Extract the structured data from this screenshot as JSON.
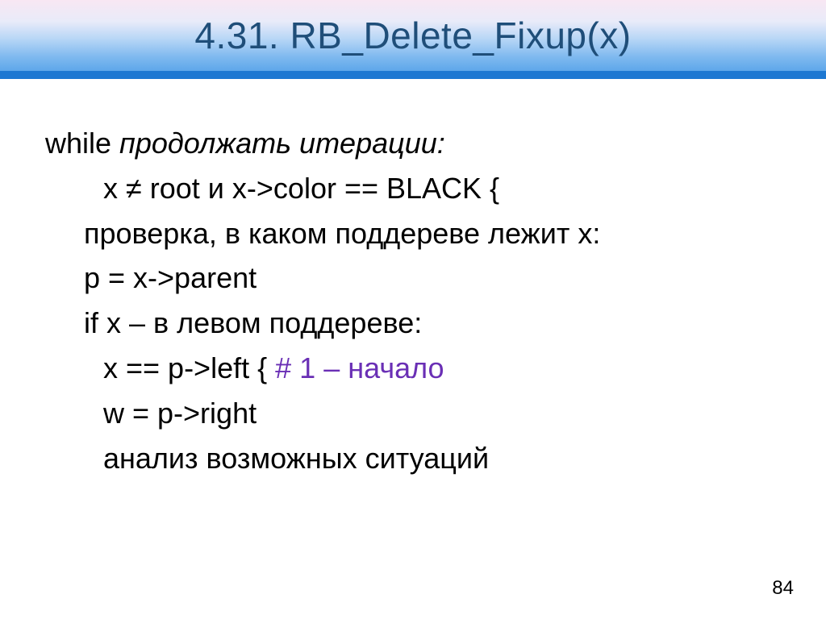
{
  "title": "4.31. RB_Delete_Fixup(x)",
  "lines": {
    "l1a": "while",
    "l1b": " продолжать итерации",
    "l1c": ":",
    "l2": "x ≠ root и x->color == BLACK {",
    "l3": "проверка, в каком поддереве лежит x:",
    "l4": "p = x->parent",
    "l5": "if x – в левом поддереве:",
    "l6a": "x == p->left { ",
    "l6b": "# 1 – начало",
    "l7": "w = p->right",
    "l8": "анализ возможных ситуаций"
  },
  "pageNumber": "84"
}
